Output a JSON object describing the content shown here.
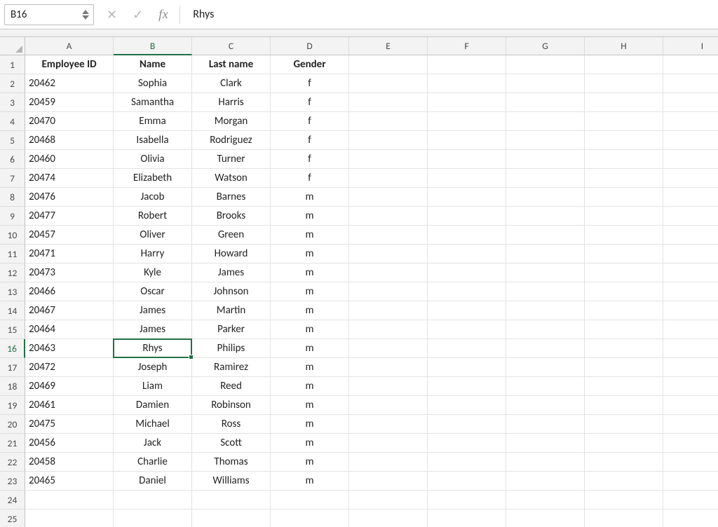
{
  "namebox": {
    "value": "B16"
  },
  "formula_bar": {
    "cancel_glyph": "✕",
    "accept_glyph": "✓",
    "fx_label": "fx",
    "value": "Rhys"
  },
  "columns": [
    "A",
    "B",
    "C",
    "D",
    "E",
    "F",
    "G",
    "H",
    "I"
  ],
  "active": {
    "col": "B",
    "row": 16
  },
  "headers": {
    "A": "Employee ID",
    "B": "Name",
    "C": "Last name",
    "D": "Gender"
  },
  "rows": [
    {
      "r": 2,
      "A": "20462",
      "B": "Sophia",
      "C": "Clark",
      "D": "f"
    },
    {
      "r": 3,
      "A": "20459",
      "B": "Samantha",
      "C": "Harris",
      "D": "f"
    },
    {
      "r": 4,
      "A": "20470",
      "B": "Emma",
      "C": "Morgan",
      "D": "f"
    },
    {
      "r": 5,
      "A": "20468",
      "B": "Isabella",
      "C": "Rodriguez",
      "D": "f"
    },
    {
      "r": 6,
      "A": "20460",
      "B": "Olivia",
      "C": "Turner",
      "D": "f"
    },
    {
      "r": 7,
      "A": "20474",
      "B": "Elizabeth",
      "C": "Watson",
      "D": "f"
    },
    {
      "r": 8,
      "A": "20476",
      "B": "Jacob",
      "C": "Barnes",
      "D": "m"
    },
    {
      "r": 9,
      "A": "20477",
      "B": "Robert",
      "C": "Brooks",
      "D": "m"
    },
    {
      "r": 10,
      "A": "20457",
      "B": "Oliver",
      "C": "Green",
      "D": "m"
    },
    {
      "r": 11,
      "A": "20471",
      "B": "Harry",
      "C": "Howard",
      "D": "m"
    },
    {
      "r": 12,
      "A": "20473",
      "B": "Kyle",
      "C": "James",
      "D": "m"
    },
    {
      "r": 13,
      "A": "20466",
      "B": "Oscar",
      "C": "Johnson",
      "D": "m"
    },
    {
      "r": 14,
      "A": "20467",
      "B": "James",
      "C": "Martin",
      "D": "m"
    },
    {
      "r": 15,
      "A": "20464",
      "B": "James",
      "C": "Parker",
      "D": "m"
    },
    {
      "r": 16,
      "A": "20463",
      "B": "Rhys",
      "C": "Philips",
      "D": "m"
    },
    {
      "r": 17,
      "A": "20472",
      "B": "Joseph",
      "C": "Ramirez",
      "D": "m"
    },
    {
      "r": 18,
      "A": "20469",
      "B": "Liam",
      "C": "Reed",
      "D": "m"
    },
    {
      "r": 19,
      "A": "20461",
      "B": "Damien",
      "C": "Robinson",
      "D": "m"
    },
    {
      "r": 20,
      "A": "20475",
      "B": "Michael",
      "C": "Ross",
      "D": "m"
    },
    {
      "r": 21,
      "A": "20456",
      "B": "Jack",
      "C": "Scott",
      "D": "m"
    },
    {
      "r": 22,
      "A": "20458",
      "B": "Charlie",
      "C": "Thomas",
      "D": "m"
    },
    {
      "r": 23,
      "A": "20465",
      "B": "Daniel",
      "C": "Williams",
      "D": "m"
    }
  ],
  "extra_blank_rows": [
    24,
    25
  ],
  "colors": {
    "accent": "#1f7246"
  }
}
